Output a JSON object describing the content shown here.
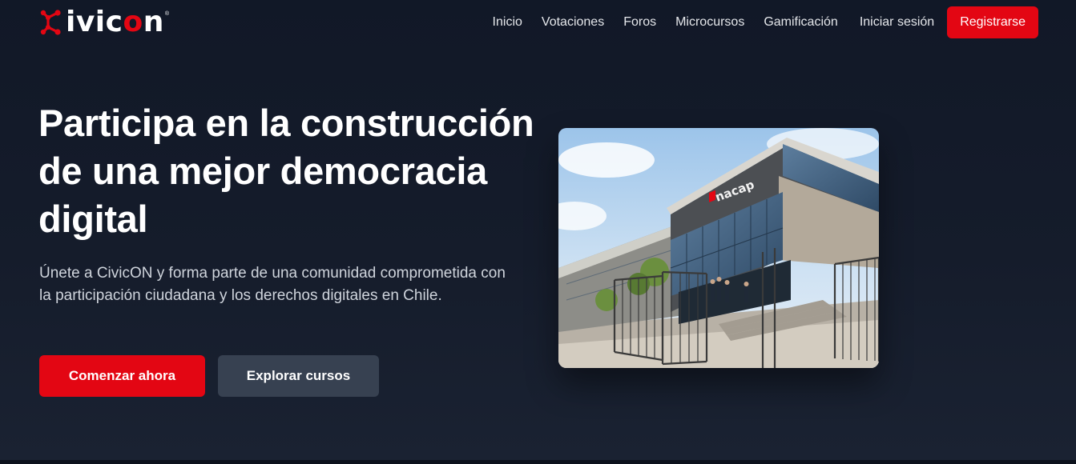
{
  "brand": {
    "name_prefix": "ivic",
    "name_o": "o",
    "name_suffix": "n",
    "registered": "®",
    "accent_color": "#e30613"
  },
  "nav": {
    "items": [
      {
        "label": "Inicio"
      },
      {
        "label": "Votaciones"
      },
      {
        "label": "Foros"
      },
      {
        "label": "Microcursos"
      },
      {
        "label": "Gamificación"
      }
    ],
    "login_label": "Iniciar sesión",
    "register_label": "Registrarse"
  },
  "hero": {
    "title": "Participa en la construcción de una mejor democracia digital",
    "subtitle": "Únete a CivicON y forma parte de una comunidad comprometida con la participación ciudadana y los derechos digitales en Chile.",
    "primary_cta": "Comenzar ahora",
    "secondary_cta": "Explorar cursos",
    "image_sign": "nacap"
  },
  "colors": {
    "background": "#111827",
    "primary": "#e30613",
    "secondary_button": "#374151",
    "subtitle_text": "#cfd4dc"
  }
}
